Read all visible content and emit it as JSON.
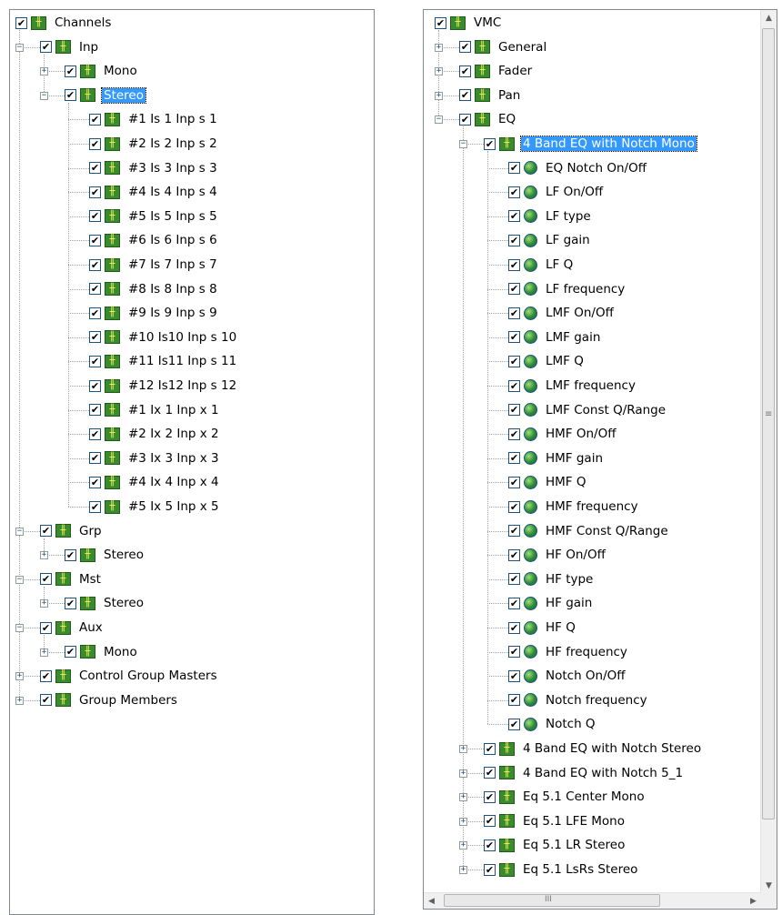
{
  "left_tree": {
    "nodes": [
      {
        "depth": 0,
        "label": "Channels",
        "icon": "channel-icon",
        "expander": "none",
        "checked": true
      },
      {
        "depth": 1,
        "label": "Inp",
        "icon": "channel-icon",
        "expander": "minus",
        "checked": true
      },
      {
        "depth": 2,
        "label": "Mono",
        "icon": "channel-icon",
        "expander": "plus",
        "checked": true
      },
      {
        "depth": 2,
        "label": "Stereo",
        "icon": "channel-icon",
        "expander": "minus",
        "checked": true,
        "selected": true
      },
      {
        "depth": 3,
        "label": "#1 Is 1 Inp s  1",
        "icon": "channel-icon",
        "expander": "none",
        "checked": true
      },
      {
        "depth": 3,
        "label": "#2 Is 2 Inp s  2",
        "icon": "channel-icon",
        "expander": "none",
        "checked": true
      },
      {
        "depth": 3,
        "label": "#3 Is 3 Inp s  3",
        "icon": "channel-icon",
        "expander": "none",
        "checked": true
      },
      {
        "depth": 3,
        "label": "#4 Is 4 Inp s  4",
        "icon": "channel-icon",
        "expander": "none",
        "checked": true
      },
      {
        "depth": 3,
        "label": "#5 Is 5 Inp s  5",
        "icon": "channel-icon",
        "expander": "none",
        "checked": true
      },
      {
        "depth": 3,
        "label": "#6 Is 6 Inp s  6",
        "icon": "channel-icon",
        "expander": "none",
        "checked": true
      },
      {
        "depth": 3,
        "label": "#7 Is 7 Inp s  7",
        "icon": "channel-icon",
        "expander": "none",
        "checked": true
      },
      {
        "depth": 3,
        "label": "#8 Is 8 Inp s  8",
        "icon": "channel-icon",
        "expander": "none",
        "checked": true
      },
      {
        "depth": 3,
        "label": "#9 Is 9 Inp s  9",
        "icon": "channel-icon",
        "expander": "none",
        "checked": true
      },
      {
        "depth": 3,
        "label": "#10 Is10 Inp s 10",
        "icon": "channel-icon",
        "expander": "none",
        "checked": true
      },
      {
        "depth": 3,
        "label": "#11 Is11 Inp s 11",
        "icon": "channel-icon",
        "expander": "none",
        "checked": true
      },
      {
        "depth": 3,
        "label": "#12 Is12 Inp s 12",
        "icon": "channel-icon",
        "expander": "none",
        "checked": true
      },
      {
        "depth": 3,
        "label": "#1 Ix 1 Inp x  1",
        "icon": "channel-icon",
        "expander": "none",
        "checked": true
      },
      {
        "depth": 3,
        "label": "#2 Ix 2 Inp x  2",
        "icon": "channel-icon",
        "expander": "none",
        "checked": true
      },
      {
        "depth": 3,
        "label": "#3 Ix 3 Inp x  3",
        "icon": "channel-icon",
        "expander": "none",
        "checked": true
      },
      {
        "depth": 3,
        "label": "#4 Ix 4 Inp x  4",
        "icon": "channel-icon",
        "expander": "none",
        "checked": true
      },
      {
        "depth": 3,
        "label": "#5 Ix 5 Inp x  5",
        "icon": "channel-icon",
        "expander": "none",
        "checked": true
      },
      {
        "depth": 1,
        "label": "Grp",
        "icon": "channel-icon",
        "expander": "minus",
        "checked": true
      },
      {
        "depth": 2,
        "label": "Stereo",
        "icon": "channel-icon",
        "expander": "plus",
        "checked": true
      },
      {
        "depth": 1,
        "label": "Mst",
        "icon": "channel-icon",
        "expander": "minus",
        "checked": true
      },
      {
        "depth": 2,
        "label": "Stereo",
        "icon": "channel-icon",
        "expander": "plus",
        "checked": true
      },
      {
        "depth": 1,
        "label": "Aux",
        "icon": "channel-icon",
        "expander": "minus",
        "checked": true
      },
      {
        "depth": 2,
        "label": "Mono",
        "icon": "channel-icon",
        "expander": "plus",
        "checked": true
      },
      {
        "depth": 1,
        "label": "Control Group Masters",
        "icon": "channel-icon",
        "expander": "plus",
        "checked": true
      },
      {
        "depth": 1,
        "label": "Group Members",
        "icon": "channel-icon",
        "expander": "plus",
        "checked": true
      }
    ]
  },
  "right_tree": {
    "nodes": [
      {
        "depth": 0,
        "label": "VMC",
        "icon": "channel-icon",
        "expander": "none",
        "checked": true
      },
      {
        "depth": 1,
        "label": "General",
        "icon": "channel-icon",
        "expander": "plus",
        "checked": true
      },
      {
        "depth": 1,
        "label": "Fader",
        "icon": "channel-icon",
        "expander": "plus",
        "checked": true
      },
      {
        "depth": 1,
        "label": "Pan",
        "icon": "channel-icon",
        "expander": "plus",
        "checked": true
      },
      {
        "depth": 1,
        "label": "EQ",
        "icon": "channel-icon",
        "expander": "minus",
        "checked": true
      },
      {
        "depth": 2,
        "label": "4 Band EQ with Notch Mono",
        "icon": "channel-icon",
        "expander": "minus",
        "checked": true,
        "selected": true
      },
      {
        "depth": 3,
        "label": "EQ Notch On/Off",
        "icon": "parameter-icon",
        "expander": "none",
        "checked": true
      },
      {
        "depth": 3,
        "label": "LF On/Off",
        "icon": "parameter-icon",
        "expander": "none",
        "checked": true
      },
      {
        "depth": 3,
        "label": "LF type",
        "icon": "parameter-icon",
        "expander": "none",
        "checked": true
      },
      {
        "depth": 3,
        "label": "LF gain",
        "icon": "parameter-icon",
        "expander": "none",
        "checked": true
      },
      {
        "depth": 3,
        "label": "LF Q",
        "icon": "parameter-icon",
        "expander": "none",
        "checked": true
      },
      {
        "depth": 3,
        "label": "LF frequency",
        "icon": "parameter-icon",
        "expander": "none",
        "checked": true
      },
      {
        "depth": 3,
        "label": "LMF On/Off",
        "icon": "parameter-icon",
        "expander": "none",
        "checked": true
      },
      {
        "depth": 3,
        "label": "LMF gain",
        "icon": "parameter-icon",
        "expander": "none",
        "checked": true
      },
      {
        "depth": 3,
        "label": "LMF Q",
        "icon": "parameter-icon",
        "expander": "none",
        "checked": true
      },
      {
        "depth": 3,
        "label": "LMF frequency",
        "icon": "parameter-icon",
        "expander": "none",
        "checked": true
      },
      {
        "depth": 3,
        "label": "LMF Const Q/Range",
        "icon": "parameter-icon",
        "expander": "none",
        "checked": true
      },
      {
        "depth": 3,
        "label": "HMF On/Off",
        "icon": "parameter-icon",
        "expander": "none",
        "checked": true
      },
      {
        "depth": 3,
        "label": "HMF gain",
        "icon": "parameter-icon",
        "expander": "none",
        "checked": true
      },
      {
        "depth": 3,
        "label": "HMF Q",
        "icon": "parameter-icon",
        "expander": "none",
        "checked": true
      },
      {
        "depth": 3,
        "label": "HMF frequency",
        "icon": "parameter-icon",
        "expander": "none",
        "checked": true
      },
      {
        "depth": 3,
        "label": "HMF Const Q/Range",
        "icon": "parameter-icon",
        "expander": "none",
        "checked": true
      },
      {
        "depth": 3,
        "label": "HF On/Off",
        "icon": "parameter-icon",
        "expander": "none",
        "checked": true
      },
      {
        "depth": 3,
        "label": "HF type",
        "icon": "parameter-icon",
        "expander": "none",
        "checked": true
      },
      {
        "depth": 3,
        "label": "HF gain",
        "icon": "parameter-icon",
        "expander": "none",
        "checked": true
      },
      {
        "depth": 3,
        "label": "HF Q",
        "icon": "parameter-icon",
        "expander": "none",
        "checked": true
      },
      {
        "depth": 3,
        "label": "HF frequency",
        "icon": "parameter-icon",
        "expander": "none",
        "checked": true
      },
      {
        "depth": 3,
        "label": "Notch On/Off",
        "icon": "parameter-icon",
        "expander": "none",
        "checked": true
      },
      {
        "depth": 3,
        "label": "Notch frequency",
        "icon": "parameter-icon",
        "expander": "none",
        "checked": true
      },
      {
        "depth": 3,
        "label": "Notch Q",
        "icon": "parameter-icon",
        "expander": "none",
        "checked": true
      },
      {
        "depth": 2,
        "label": "4 Band EQ with Notch Stereo",
        "icon": "channel-icon",
        "expander": "plus",
        "checked": true
      },
      {
        "depth": 2,
        "label": "4 Band EQ with Notch 5_1",
        "icon": "channel-icon",
        "expander": "plus",
        "checked": true
      },
      {
        "depth": 2,
        "label": "Eq 5.1 Center Mono",
        "icon": "channel-icon",
        "expander": "plus",
        "checked": true
      },
      {
        "depth": 2,
        "label": "Eq 5.1 LFE Mono",
        "icon": "channel-icon",
        "expander": "plus",
        "checked": true
      },
      {
        "depth": 2,
        "label": "Eq 5.1 LR Stereo",
        "icon": "channel-icon",
        "expander": "plus",
        "checked": true
      },
      {
        "depth": 2,
        "label": "Eq 5.1 LsRs Stereo",
        "icon": "channel-icon",
        "expander": "plus",
        "checked": true
      }
    ]
  },
  "scrollbar": {
    "up_arrow": "▲",
    "down_arrow": "▼",
    "left_arrow": "◀",
    "right_arrow": "▶",
    "grip": "≡",
    "hgrip": "III"
  },
  "colors": {
    "selection": "#3399ff",
    "node_icon": "#3a8a2e",
    "border": "#828790"
  }
}
